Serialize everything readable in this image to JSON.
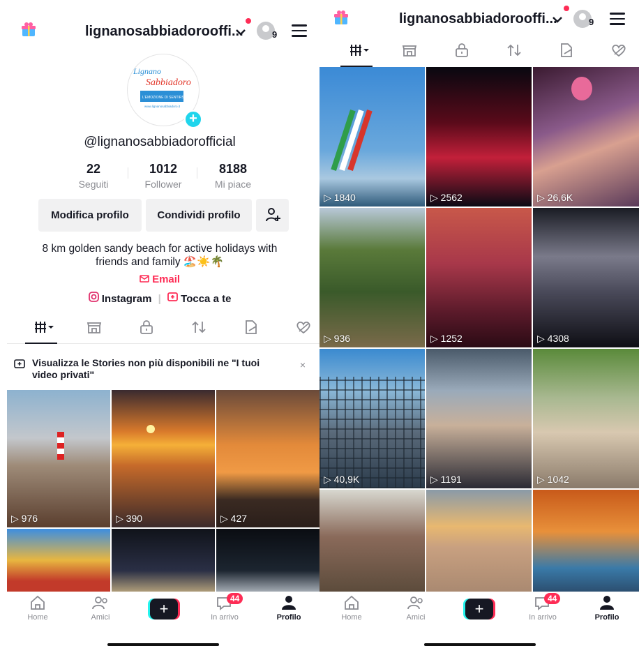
{
  "colors": {
    "accent": "#fe2c55",
    "cyan": "#20d5ec",
    "text": "#161823",
    "muted": "#8a8b91"
  },
  "header": {
    "username": "lignanosabbiadorooffi...",
    "account_count": "9"
  },
  "profile": {
    "avatar_text": [
      "Lignano",
      "Sabbiadoro",
      "L'EMOZIONE DI SENTIRSI BENE",
      "www.lignanosabbiadoro.it"
    ],
    "handle": "@lignanosabbiadorofficial",
    "stats": [
      {
        "value": "22",
        "label": "Seguiti"
      },
      {
        "value": "1012",
        "label": "Follower"
      },
      {
        "value": "8188",
        "label": "Mi piace"
      }
    ],
    "edit_label": "Modifica profilo",
    "share_label": "Condividi profilo",
    "bio_line1": "8 km golden sandy beach for active holidays with",
    "bio_line2": "friends and family 🏖️☀️🌴",
    "email": "Email",
    "instagram": "Instagram",
    "tocca": "Tocca a te"
  },
  "tabs": [
    "videos-grid",
    "shop",
    "private",
    "reposts",
    "hidden",
    "liked"
  ],
  "notice": {
    "text": "Visualizza le Stories non più disponibili ne \"I tuoi video privati\"",
    "close": "×"
  },
  "left_videos": [
    {
      "views": "976"
    },
    {
      "views": "390"
    },
    {
      "views": "427"
    },
    {
      "views": ""
    },
    {
      "views": ""
    },
    {
      "views": ""
    }
  ],
  "right_videos": [
    {
      "views": "1840"
    },
    {
      "views": "2562"
    },
    {
      "views": "26,6K"
    },
    {
      "views": "936"
    },
    {
      "views": "1252"
    },
    {
      "views": "4308"
    },
    {
      "views": "40,9K"
    },
    {
      "views": "1191"
    },
    {
      "views": "1042"
    },
    {
      "views": ""
    },
    {
      "views": ""
    },
    {
      "views": ""
    }
  ],
  "nav": {
    "home": "Home",
    "friends": "Amici",
    "create": "+",
    "inbox": "In arrivo",
    "inbox_badge": "44",
    "profile": "Profilo"
  }
}
